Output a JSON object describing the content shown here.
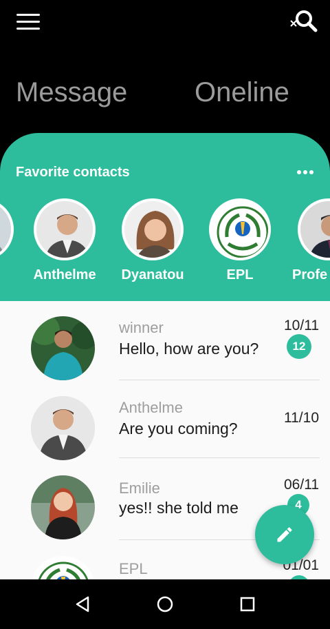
{
  "header": {
    "menu_icon": "hamburger-menu-icon",
    "search_icon": "search-close-icon"
  },
  "tabs": [
    {
      "label": "Message"
    },
    {
      "label": "Oneline"
    }
  ],
  "favorites": {
    "title": "Favorite contacts",
    "more_icon": "more-horizontal-icon",
    "contacts": [
      {
        "name": "Anthelme"
      },
      {
        "name": "Dyanatou"
      },
      {
        "name": "EPL"
      },
      {
        "name": "Profe"
      }
    ]
  },
  "chats": [
    {
      "name": "winner",
      "message": "Hello, how are you?",
      "date": "10/11",
      "unread": "12"
    },
    {
      "name": "Anthelme",
      "message": "Are you coming?",
      "date": "11/10",
      "unread": ""
    },
    {
      "name": "Emilie",
      "message": "yes!! she told me",
      "date": "06/11",
      "unread": "4"
    },
    {
      "name": "EPL",
      "message": "",
      "date": "01/01",
      "unread": ""
    }
  ],
  "fab": {
    "icon": "pencil-edit-icon"
  },
  "system_nav": {
    "back_icon": "back-triangle-icon",
    "home_icon": "home-circle-icon",
    "recents_icon": "recents-square-icon"
  },
  "colors": {
    "accent": "#2dbd9d",
    "background": "#000000",
    "list_bg": "#fafafa"
  }
}
